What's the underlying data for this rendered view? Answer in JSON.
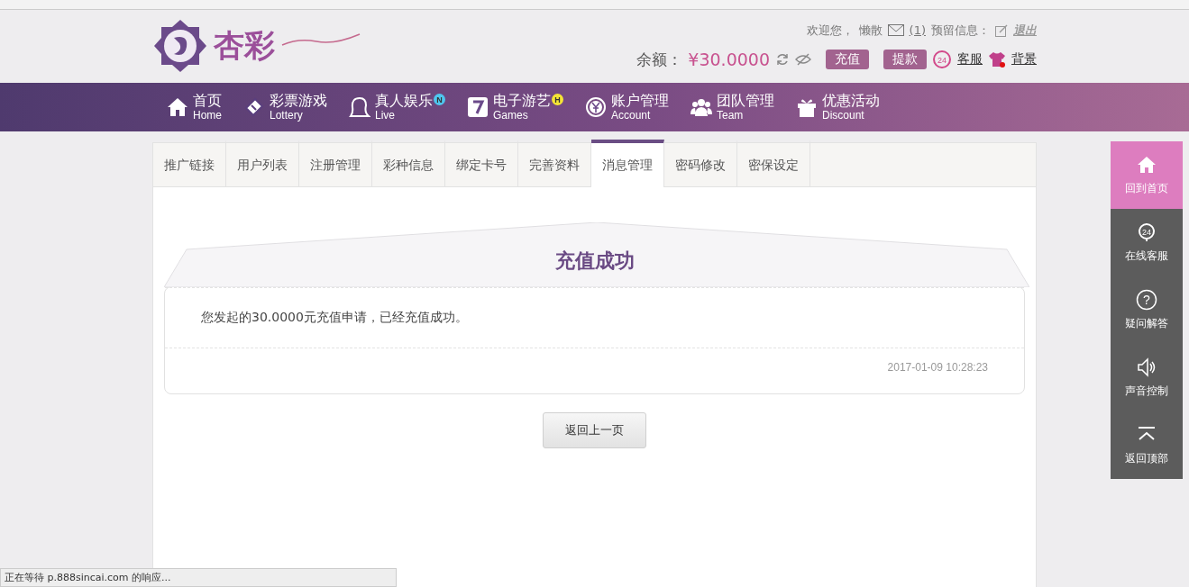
{
  "header": {
    "logo_text": "杏彩",
    "welcome": "欢迎您，",
    "username": "懒散",
    "messages": "(1)",
    "reserved_label": "预留信息：",
    "logout": "退出",
    "balance_label": "余额：",
    "balance": "¥30.0000",
    "deposit": "充值",
    "withdraw": "提款",
    "service_icon_text": "24",
    "service": "客服",
    "background": "背景"
  },
  "nav": [
    {
      "label": "首页",
      "sub": "Home"
    },
    {
      "label": "彩票游戏",
      "sub": "Lottery"
    },
    {
      "label": "真人娱乐",
      "sub": "Live",
      "badge": {
        "text": "N",
        "color": "#4fc6ef"
      }
    },
    {
      "label": "电子游艺",
      "sub": "Games",
      "badge": {
        "text": "H",
        "color": "#f5e535"
      }
    },
    {
      "label": "账户管理",
      "sub": "Account"
    },
    {
      "label": "团队管理",
      "sub": "Team"
    },
    {
      "label": "优惠活动",
      "sub": "Discount"
    }
  ],
  "tabs": [
    {
      "label": "推广链接",
      "selected": false
    },
    {
      "label": "用户列表",
      "selected": false
    },
    {
      "label": "注册管理",
      "selected": false
    },
    {
      "label": "彩种信息",
      "selected": false
    },
    {
      "label": "绑定卡号",
      "selected": false
    },
    {
      "label": "完善资料",
      "selected": false
    },
    {
      "label": "消息管理",
      "selected": true
    },
    {
      "label": "密码修改",
      "selected": false
    },
    {
      "label": "密保设定",
      "selected": false
    }
  ],
  "message": {
    "title": "充值成功",
    "body": "您发起的30.0000元充值申请，已经充值成功。",
    "time": "2017-01-09 10:28:23"
  },
  "back_button": "返回上一页",
  "side_menu": [
    {
      "label": "回到首页",
      "selected": true
    },
    {
      "label": "在线客服",
      "icon_text": "24",
      "selected": false
    },
    {
      "label": "疑问解答",
      "icon_text": "?",
      "selected": false
    },
    {
      "label": "声音控制",
      "selected": false
    },
    {
      "label": "返回顶部",
      "selected": false
    }
  ],
  "status_bar": "正在等待 p.888sincai.com 的响应..."
}
